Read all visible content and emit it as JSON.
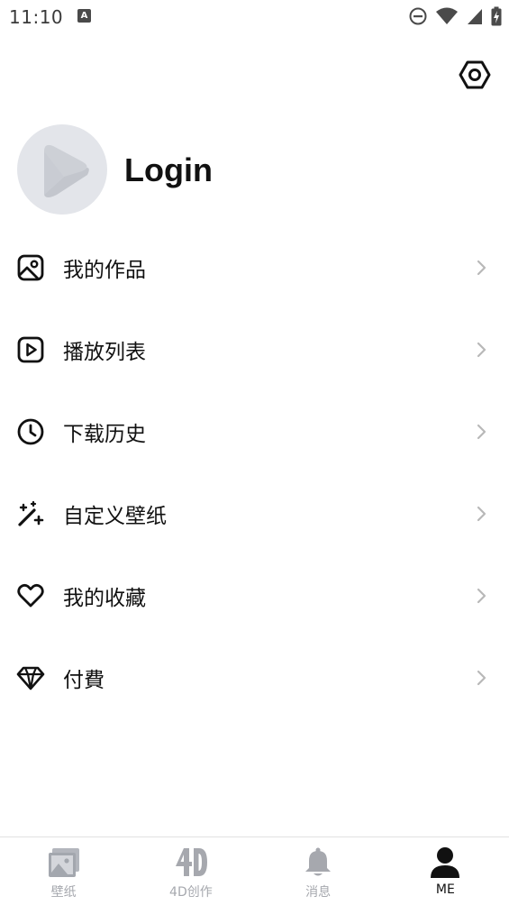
{
  "status_bar": {
    "time": "11:10",
    "notification_letter": "A",
    "icons": [
      "do-not-disturb-icon",
      "wifi-icon",
      "cellular-signal-icon",
      "battery-charging-icon"
    ]
  },
  "header": {
    "settings_icon": "hexagon-settings-icon"
  },
  "profile": {
    "login_label": "Login",
    "avatar_icon": "play-logo-icon"
  },
  "menu": {
    "items": [
      {
        "label": "我的作品",
        "icon": "image-icon"
      },
      {
        "label": "播放列表",
        "icon": "play-square-icon"
      },
      {
        "label": "下载历史",
        "icon": "clock-icon"
      },
      {
        "label": "自定义壁纸",
        "icon": "magic-wand-icon"
      },
      {
        "label": "我的收藏",
        "icon": "heart-icon"
      },
      {
        "label": "付費",
        "icon": "diamond-icon"
      }
    ]
  },
  "bottom_nav": {
    "items": [
      {
        "label": "壁纸",
        "icon": "wallpaper-icon"
      },
      {
        "label": "4D创作",
        "icon": "4d-icon"
      },
      {
        "label": "消息",
        "icon": "bell-icon"
      },
      {
        "label": "ME",
        "icon": "person-icon"
      }
    ],
    "active": "ME"
  },
  "colors": {
    "text_primary": "#111111",
    "chevron": "#b8b8b8",
    "avatar_bg": "#e3e5ea",
    "nav_inactive": "#a6a8ae",
    "nav_active": "#111111"
  }
}
